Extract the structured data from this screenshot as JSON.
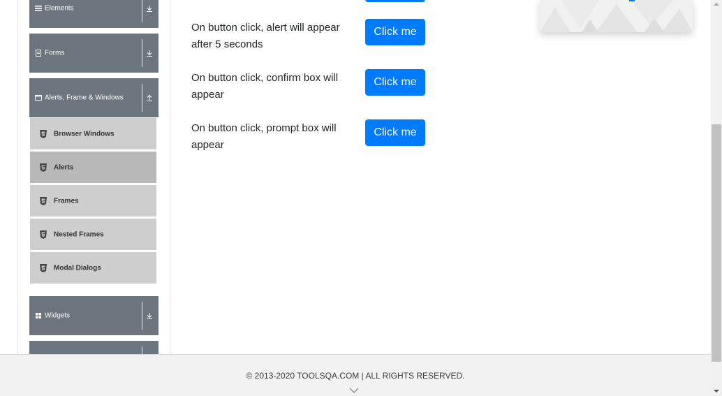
{
  "sidebar": {
    "groups": [
      {
        "label": "Elements",
        "icon": "menu-lines-icon",
        "expanded": false
      },
      {
        "label": "Forms",
        "icon": "document-icon",
        "expanded": false
      },
      {
        "label": "Alerts, Frame & Windows",
        "icon": "window-icon",
        "expanded": true
      },
      {
        "label": "Widgets",
        "icon": "grid-icon",
        "expanded": false
      }
    ],
    "items": [
      {
        "label": "Browser Windows",
        "icon": "html5-icon",
        "active": false
      },
      {
        "label": "Alerts",
        "icon": "html5-icon",
        "active": true
      },
      {
        "label": "Frames",
        "icon": "html5-icon",
        "active": false
      },
      {
        "label": "Nested Frames",
        "icon": "html5-icon",
        "active": false
      },
      {
        "label": "Modal Dialogs",
        "icon": "html5-icon",
        "active": false
      }
    ]
  },
  "main": {
    "rows": [
      {
        "text": "On button click, alert will appear after 5 seconds",
        "button": "Click me"
      },
      {
        "text": "On button click, confirm box will appear",
        "button": "Click me"
      },
      {
        "text": "On button click, prompt box will appear",
        "button": "Click me"
      }
    ]
  },
  "footer": {
    "text": "© 2013-2020 TOOLSQA.COM | ALL RIGHTS RESERVED."
  },
  "colors": {
    "primary": "#007bff",
    "group_header": "#6c757d",
    "menu_item": "#cecece",
    "menu_item_active": "#b8b8b8"
  }
}
